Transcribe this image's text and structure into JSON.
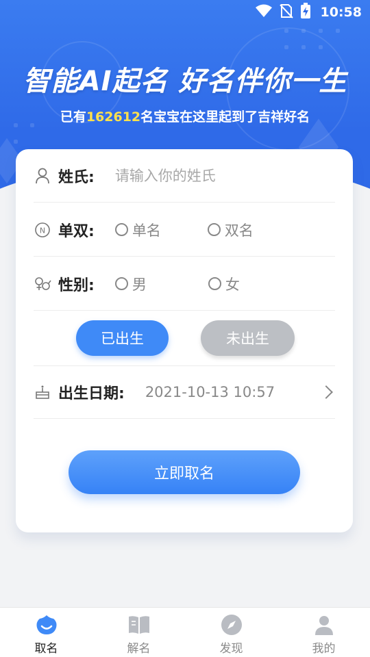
{
  "status_bar": {
    "time": "10:58"
  },
  "hero": {
    "title": "智能AI起名 好名伴你一生",
    "subtitle_prefix": "已有",
    "subtitle_count": "162612",
    "subtitle_suffix": "名宝宝在这里起到了吉祥好名"
  },
  "form": {
    "surname": {
      "label": "姓氏:",
      "placeholder": "请输入你的姓氏",
      "value": ""
    },
    "name_length": {
      "label": "单双:",
      "options": [
        "单名",
        "双名"
      ]
    },
    "gender": {
      "label": "性别:",
      "options": [
        "男",
        "女"
      ]
    },
    "birth_status": {
      "born_label": "已出生",
      "unborn_label": "未出生",
      "selected": "已出生"
    },
    "birth_date": {
      "label": "出生日期:",
      "value": "2021-10-13 10:57"
    },
    "submit_label": "立即取名"
  },
  "tabs": [
    {
      "label": "取名",
      "icon": "naming-icon",
      "active": true
    },
    {
      "label": "解名",
      "icon": "book-icon",
      "active": false
    },
    {
      "label": "发现",
      "icon": "compass-icon",
      "active": false
    },
    {
      "label": "我的",
      "icon": "user-icon",
      "active": false
    }
  ],
  "colors": {
    "primary": "#3f8af7",
    "hero_bg": "#2f6ae8",
    "highlight": "#ffe14d",
    "disabled": "#bcbfc4"
  }
}
